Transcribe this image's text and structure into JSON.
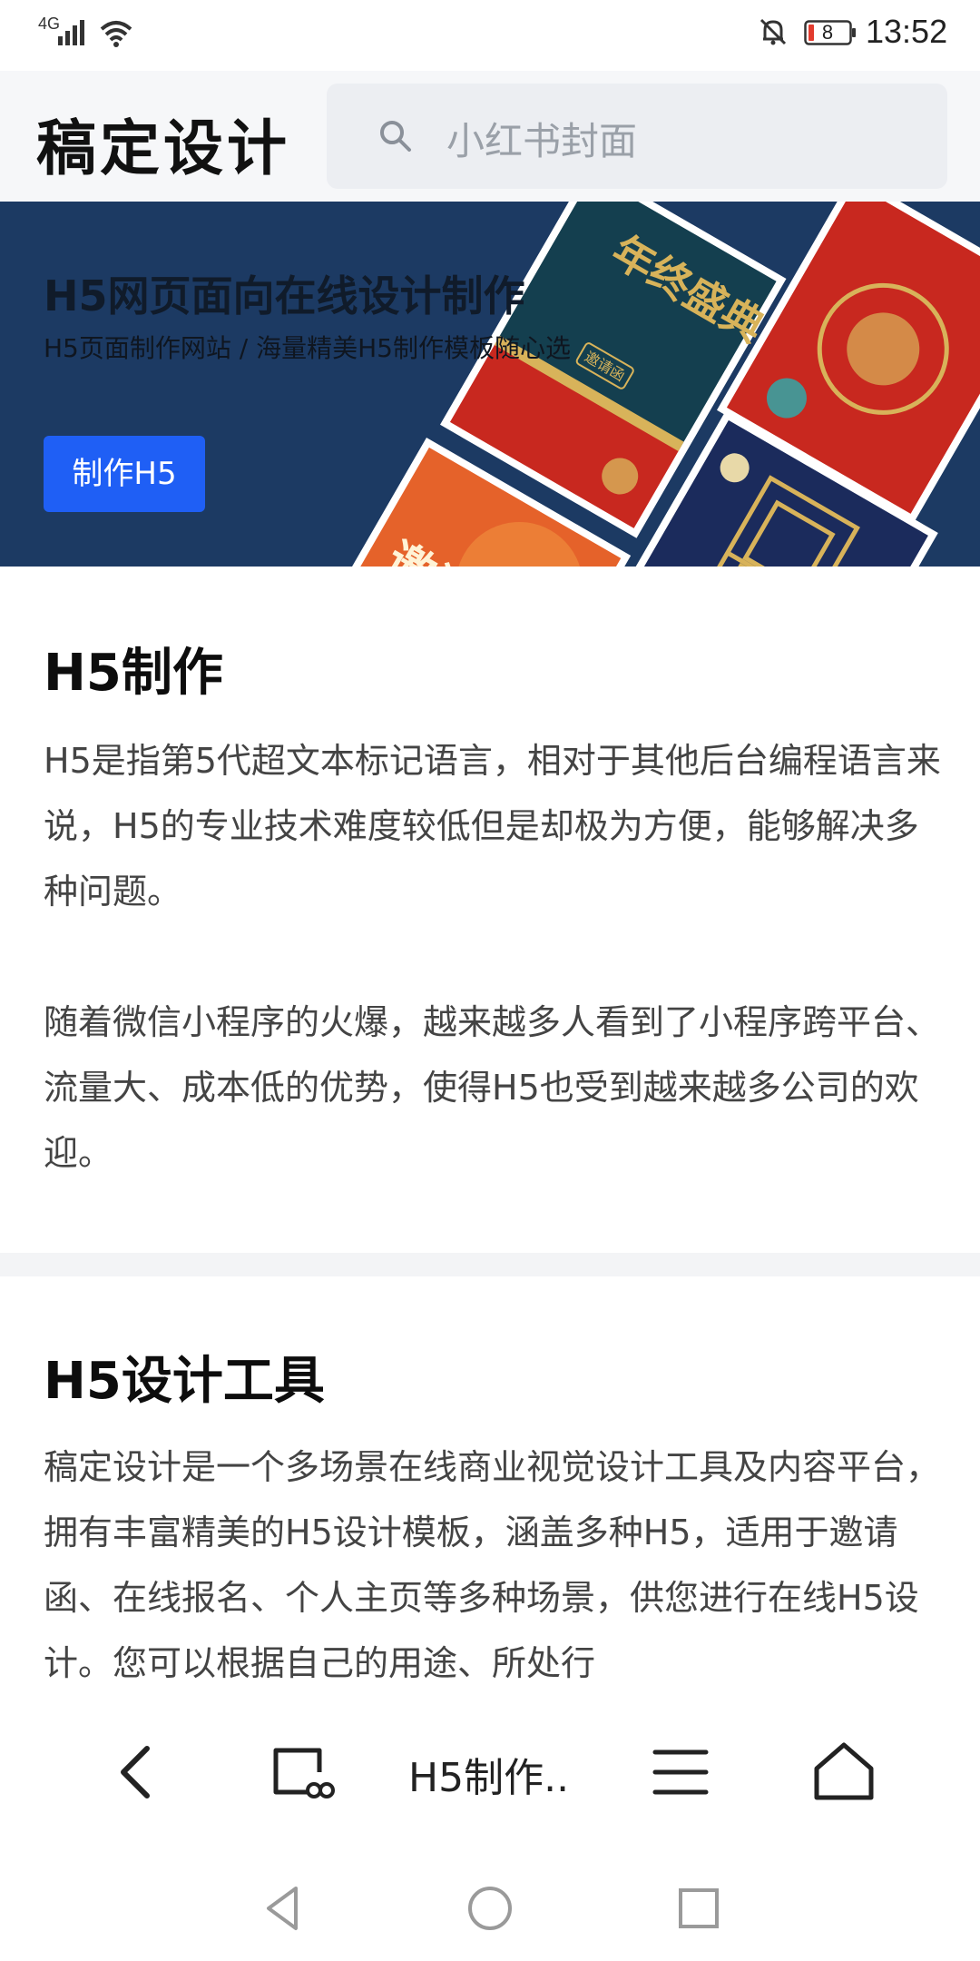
{
  "status_bar": {
    "network": "4G",
    "battery": "8",
    "time": "13:52",
    "icons": [
      "signal-icon",
      "wifi-icon",
      "bell-muted-icon",
      "battery-icon"
    ]
  },
  "header": {
    "brand": "稿定设计",
    "search_placeholder": "小红书封面"
  },
  "banner": {
    "title": "H5网页面向在线设计制作",
    "subtitle": "H5页面制作网站 / 海量精美H5制作模板随心选",
    "button": "制作H5",
    "card_text": {
      "card1": "年终盛典",
      "card1_badge": "邀请函",
      "card4": "邀请"
    }
  },
  "article": {
    "section1": {
      "title": "H5制作",
      "para1": "H5是指第5代超文本标记语言，相对于其他后台编程语言来说，H5的专业技术难度较低但是却极为方便，能够解决多种问题。",
      "para2": "随着微信小程序的火爆，越来越多人看到了小程序跨平台、流量大、成本低的优势，使得H5也受到越来越多公司的欢迎。"
    },
    "section2": {
      "title": "H5设计工具",
      "para1": "稿定设计是一个多场景在线商业视觉设计工具及内容平台，拥有丰富精美的H5设计模板，涵盖多种H5，适用于邀请函、在线报名、个人主页等多种场景，供您进行在线H5设计。您可以根据自己的用途、所处行"
    }
  },
  "toolbar": {
    "page_title": "H5制作..",
    "icons": [
      "back-icon",
      "tabs-icon",
      "menu-icon",
      "home-icon"
    ]
  },
  "system_nav": {
    "icons": [
      "nav-back-icon",
      "nav-home-icon",
      "nav-recents-icon"
    ]
  },
  "colors": {
    "banner_bg": "#1c3a63",
    "button": "#1f5ff5",
    "header_bg": "#f6f7f9",
    "search_bg": "#eceef2",
    "card_red": "#c8281f",
    "card_gold": "#d8b35a"
  }
}
